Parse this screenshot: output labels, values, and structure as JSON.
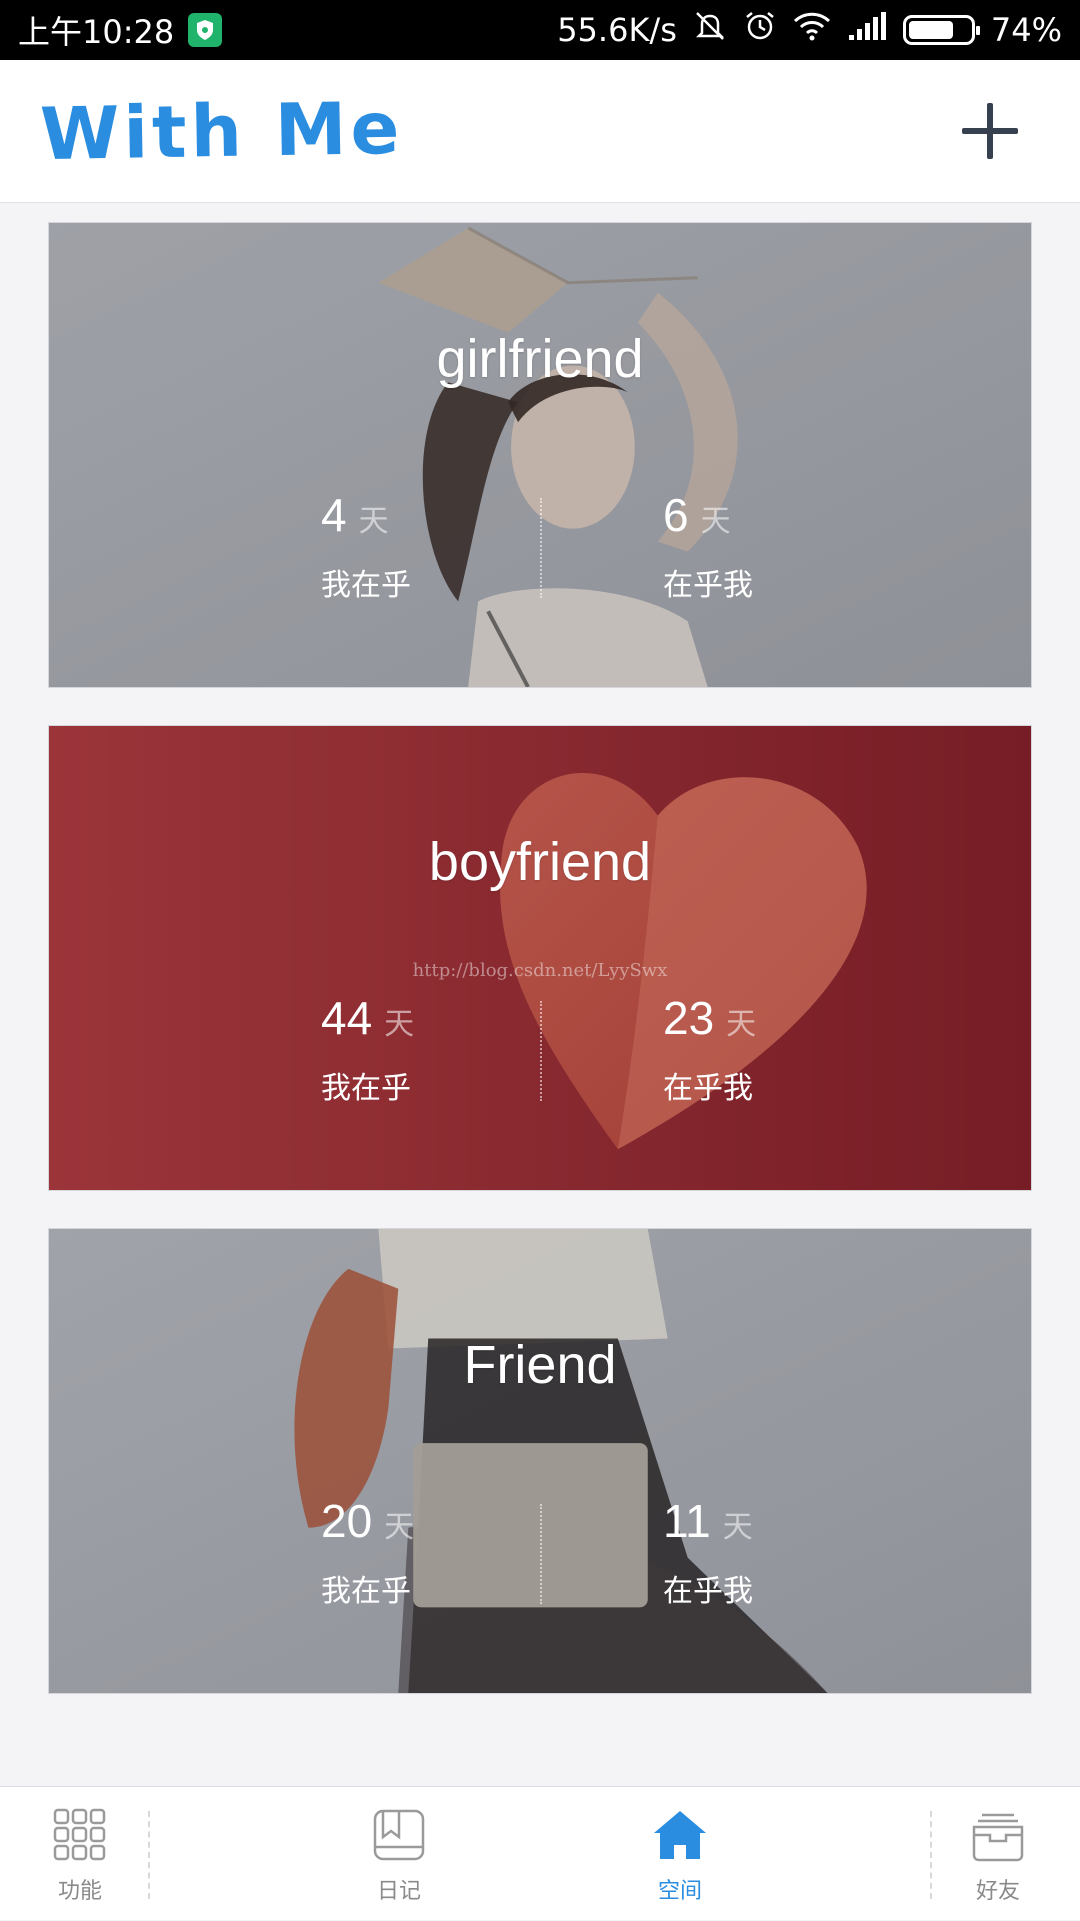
{
  "status_bar": {
    "time": "上午10:28",
    "network_speed": "55.6K/s",
    "battery_percent": "74%",
    "battery_level": 0.74,
    "icons": [
      "shield-icon",
      "mute-icon",
      "alarm-icon",
      "wifi-icon",
      "signal-icon",
      "battery-icon"
    ]
  },
  "app_bar": {
    "title": "With Me",
    "title_color": "#2a8de0",
    "add_icon": "plus-icon"
  },
  "cards": [
    {
      "title": "girlfriend",
      "theme": "gray-illustration",
      "left": {
        "value": "4",
        "unit": "天",
        "label": "我在乎"
      },
      "right": {
        "value": "6",
        "unit": "天",
        "label": "在乎我"
      }
    },
    {
      "title": "boyfriend",
      "theme": "red-heart",
      "watermark": "http://blog.csdn.net/LyySwx",
      "left": {
        "value": "44",
        "unit": "天",
        "label": "我在乎"
      },
      "right": {
        "value": "23",
        "unit": "天",
        "label": "在乎我"
      }
    },
    {
      "title": "Friend",
      "theme": "gray-illustration",
      "left": {
        "value": "20",
        "unit": "天",
        "label": "我在乎"
      },
      "right": {
        "value": "11",
        "unit": "天",
        "label": "在乎我"
      }
    }
  ],
  "bottom_nav": {
    "active_color": "#2a8de0",
    "items": [
      {
        "label": "功能",
        "icon": "grid-icon",
        "active": false
      },
      {
        "label": "日记",
        "icon": "diary-icon",
        "active": false
      },
      {
        "label": "空间",
        "icon": "home-icon",
        "active": true
      },
      {
        "label": "好友",
        "icon": "friends-box-icon",
        "active": false
      }
    ]
  }
}
